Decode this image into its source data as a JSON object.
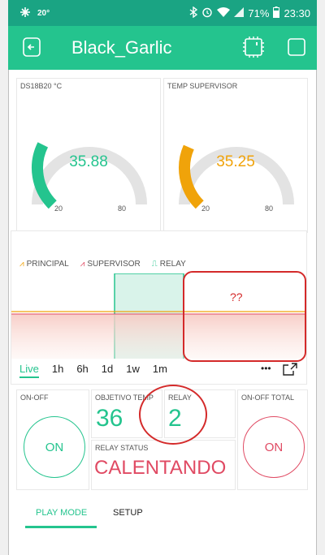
{
  "status_bar": {
    "signal_text": "20°",
    "battery_percent": "71%",
    "time": "23:30"
  },
  "app_bar": {
    "title": "Black_Garlic",
    "bg_color": "#24c48e"
  },
  "gauges": [
    {
      "label": "DS18B20 °C",
      "value": "35.88",
      "min": "20",
      "max": "80",
      "color": "#24c48e",
      "level": 0.265
    },
    {
      "label": "TEMP SUPERVISOR",
      "value": "35.25",
      "min": "20",
      "max": "80",
      "color": "#f0a30a",
      "level": 0.254
    }
  ],
  "chart": {
    "legend": [
      {
        "name": "PRINCIPAL",
        "color": "#f0a30a"
      },
      {
        "name": "SUPERVISOR",
        "color": "#e04a63"
      },
      {
        "name": "RELAY",
        "color": "#24c48e"
      }
    ],
    "time_ranges": [
      "Live",
      "1h",
      "6h",
      "1d",
      "1w",
      "1m"
    ],
    "selected_range": "Live",
    "more_label": "•••",
    "annotation": "??"
  },
  "controls": {
    "on_off_label": "ON-OFF",
    "on_off_button": "ON",
    "objetivo_label": "OBJETIVO TEMP",
    "objetivo_value": "36",
    "relay_label": "RELAY",
    "relay_value": "2",
    "on_off_total_label": "ON-OFF TOTAL",
    "on_off_total_button": "ON",
    "relay_status_label": "RELAY STATUS",
    "relay_status_value": "CALENTANDO"
  },
  "tabs": [
    {
      "label": "PLAY MODE",
      "active": true
    },
    {
      "label": "SETUP",
      "active": false
    }
  ]
}
